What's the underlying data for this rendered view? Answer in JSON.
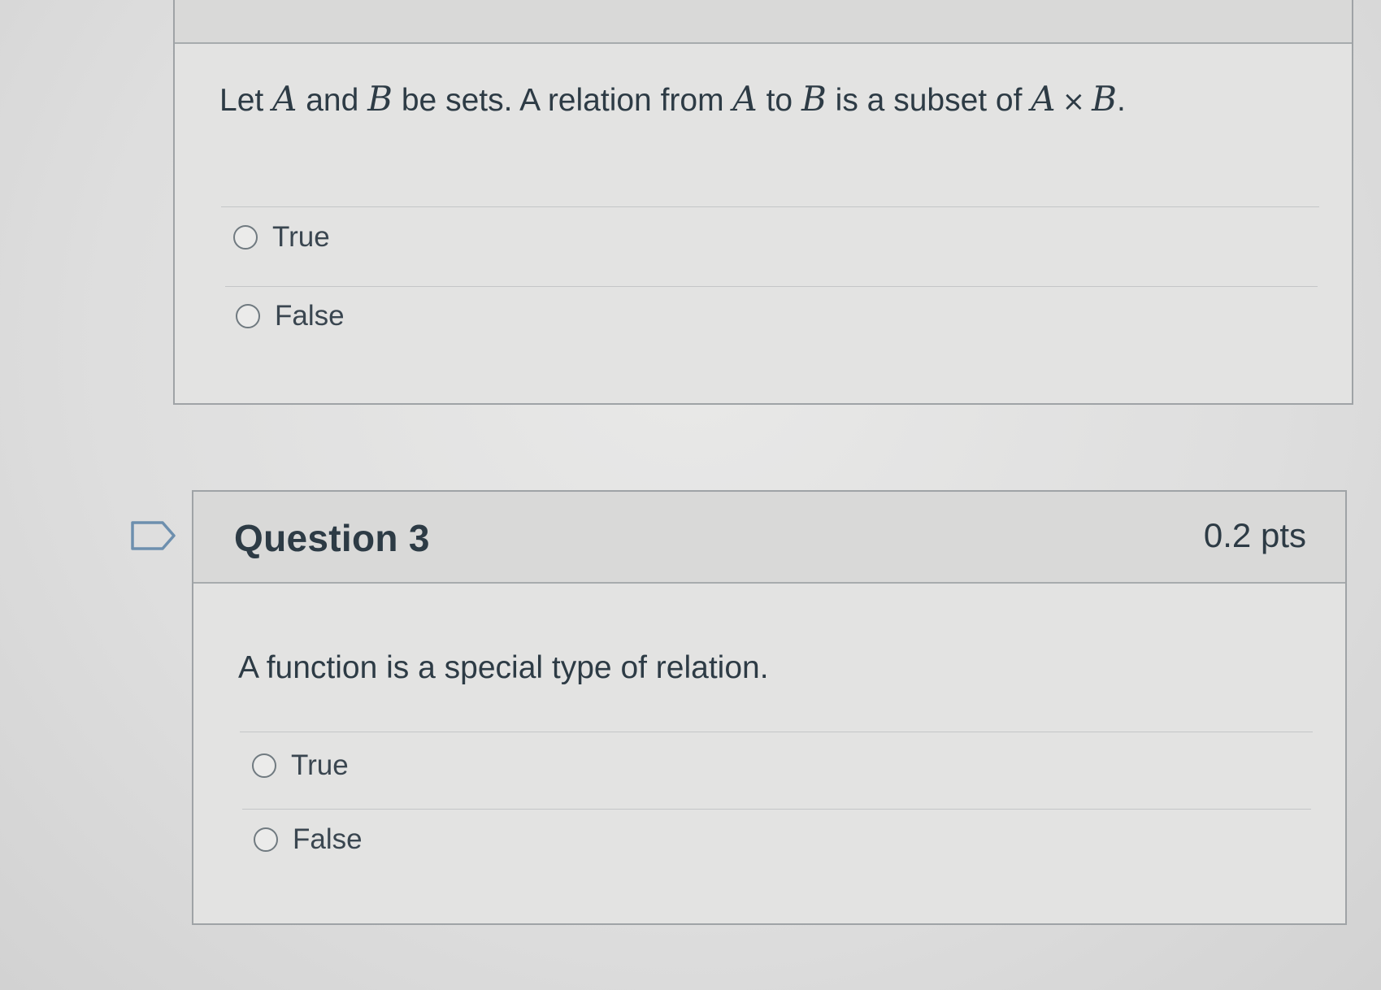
{
  "question2": {
    "text_parts": [
      "Let ",
      "A",
      " and ",
      "B",
      " be sets. A relation from ",
      "A",
      " to ",
      "B",
      " is a subset of ",
      "A",
      "×",
      "B",
      "."
    ],
    "answers": [
      {
        "label": "True"
      },
      {
        "label": "False"
      }
    ]
  },
  "question3": {
    "title": "Question 3",
    "points": "0.2 pts",
    "text": "A function is a special type of relation.",
    "answers": [
      {
        "label": "True"
      },
      {
        "label": "False"
      }
    ]
  },
  "icons": {
    "flag": "flag-outline-icon",
    "radio": "radio-unselected-icon"
  },
  "colors": {
    "text": "#2d3b45",
    "border": "#9fa3a6",
    "flag": "#6d8fae"
  }
}
